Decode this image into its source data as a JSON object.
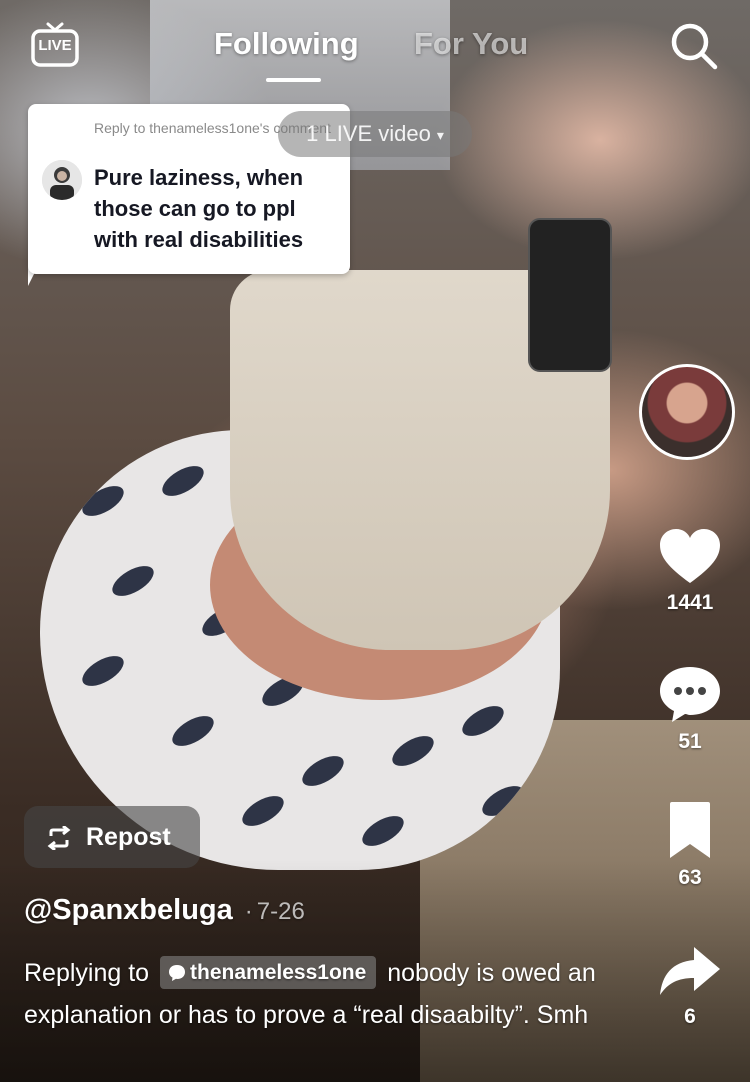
{
  "nav": {
    "live_label": "LIVE",
    "tabs": [
      {
        "label": "Following",
        "active": true
      },
      {
        "label": "For You",
        "active": false
      }
    ]
  },
  "reply_card": {
    "meta": "Reply to thenameless1one's comment",
    "text": "Pure laziness, when those can go to ppl with real disabilities"
  },
  "live_video": {
    "label": "1 LIVE video",
    "caret": "▾"
  },
  "rail": {
    "likes": "1441",
    "comments": "51",
    "saves": "63",
    "shares": "6"
  },
  "repost": {
    "label": "Repost"
  },
  "post": {
    "handle": "@Spanxbeluga",
    "separator": "·",
    "date": "7-26",
    "caption_prefix": "Replying to",
    "mention": "thenameless1one",
    "caption_body": "nobody is owed an explanation or has to prove a “real disaabilty”. Smh"
  },
  "colors": {
    "card_bg": "#ffffff",
    "card_text": "#161823",
    "meta_text": "#8a8a8a",
    "overlay_white": "#ffffff"
  },
  "icons": [
    "live-icon",
    "search-icon",
    "heart-icon",
    "comment-icon",
    "bookmark-icon",
    "share-icon",
    "repost-icon",
    "comment-bubble-icon"
  ]
}
